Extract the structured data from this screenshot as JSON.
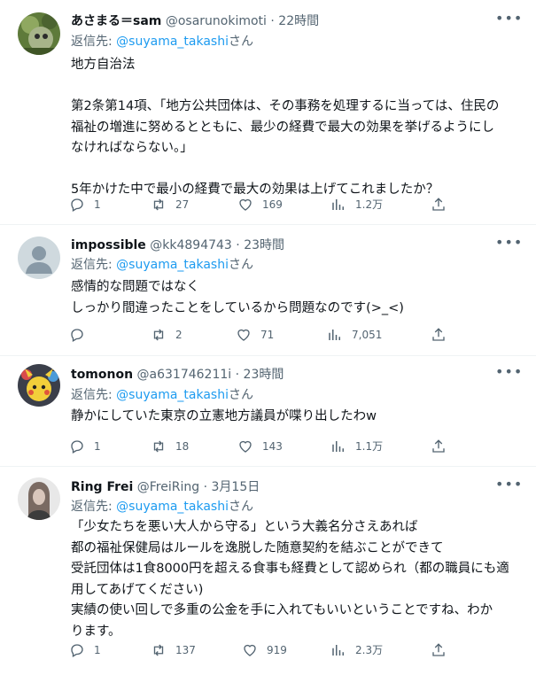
{
  "reply_prefix": "返信先: ",
  "tweets": [
    {
      "name": "あさまる＝sam",
      "handle": "@osarunokimoti",
      "time": "22時間",
      "reply_to": "@suyama_takashi",
      "reply_suffix": "さん",
      "body": [
        "地方自治法",
        "",
        "第2条第14項、「地方公共団体は、その事務を処理するに当っては、住民の",
        "福祉の増進に努めるとともに、最少の経費で最大の効果を挙げるようにし",
        "なければならない。」",
        "",
        "5年かけた中で最小の経費で最大の効果は上げてこれましたか？"
      ],
      "replies": "1",
      "retweets": "27",
      "likes": "169",
      "views": "1.2万"
    },
    {
      "name": "impossible",
      "handle": "@kk4894743",
      "time": "23時間",
      "reply_to": "@suyama_takashi",
      "reply_suffix": "さん",
      "body": [
        "感情的な問題ではなく",
        "しっかり間違ったことをしているから問題なのです(>_<)"
      ],
      "replies": "",
      "retweets": "2",
      "likes": "71",
      "views": "7,051"
    },
    {
      "name": "tomonon",
      "handle": "@a631746211i",
      "time": "23時間",
      "reply_to": "@suyama_takashi",
      "reply_suffix": "さん",
      "body": [
        "静かにしていた東京の立憲地方議員が喋り出したわw"
      ],
      "replies": "1",
      "retweets": "18",
      "likes": "143",
      "views": "1.1万"
    },
    {
      "name": "Ring Frei",
      "handle": "@FreiRing",
      "time": "3月15日",
      "reply_to": "@suyama_takashi",
      "reply_suffix": "さん",
      "body": [
        "「少女たちを悪い大人から守る」という大義名分さえあれば",
        "都の福祉保健局はルールを逸脱した随意契約を結ぶことができて",
        "受託団体は1食8000円を超える食事も経費として認められ（都の職員にも適",
        "用してあげてください)",
        "実績の使い回しで多重の公金を手に入れてもいいということですね、わか",
        "ります。"
      ],
      "replies": "1",
      "retweets": "137",
      "likes": "919",
      "views": "2.3万"
    }
  ],
  "colors": {
    "text": "#0f1419",
    "secondary": "#536471",
    "link": "#1d9bf0",
    "divider": "#eff3f4"
  }
}
